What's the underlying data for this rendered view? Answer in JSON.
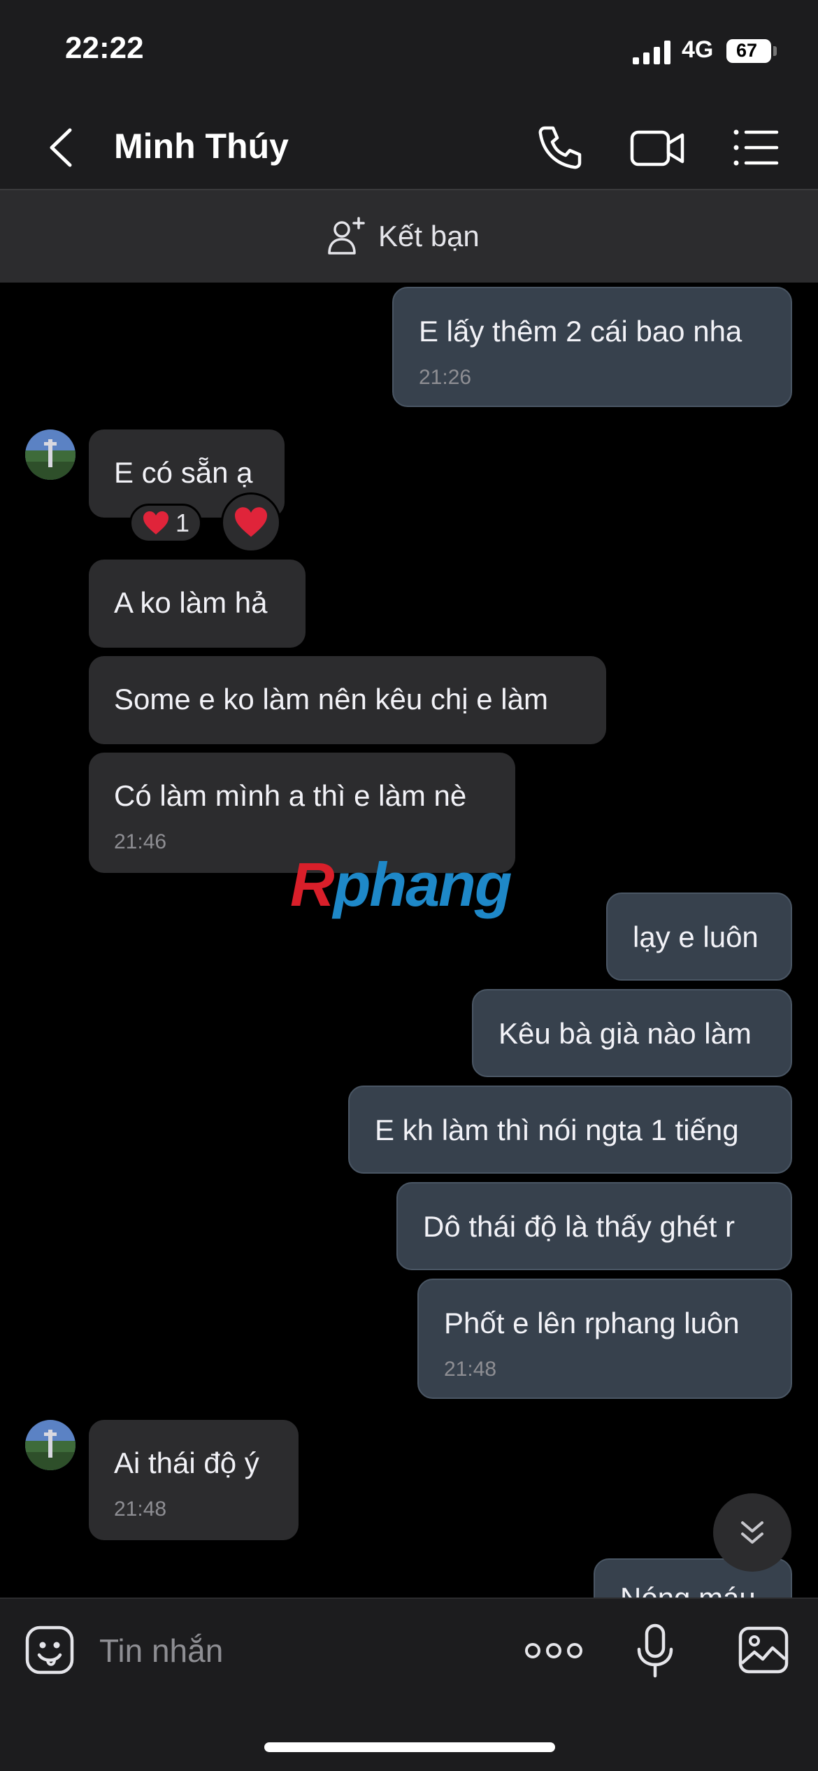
{
  "status_bar": {
    "time": "22:22",
    "network": "4G",
    "battery": "67"
  },
  "header": {
    "contact_name": "Minh Thúy",
    "icons": [
      "back-icon",
      "phone-icon",
      "video-icon",
      "menu-icon"
    ]
  },
  "friend_bar": {
    "label": "Kết bạn",
    "icon": "add-friend-icon"
  },
  "messages": [
    {
      "direction": "out",
      "text": "E lấy thêm 2 cái bao nha",
      "time": "21:26"
    },
    {
      "direction": "in",
      "text": "E có sẵn ạ",
      "reaction": "heart",
      "reaction_count": "1"
    },
    {
      "direction": "in",
      "text": "A ko làm hả"
    },
    {
      "direction": "in",
      "text": "Some e ko làm nên kêu chị e làm"
    },
    {
      "direction": "in",
      "text": "Có làm mình a thì e làm nè",
      "time": "21:46"
    },
    {
      "direction": "out",
      "text": "lạy e luôn"
    },
    {
      "direction": "out",
      "text": "Kêu bà già nào làm"
    },
    {
      "direction": "out",
      "text": "E kh làm thì nói ngta 1 tiếng"
    },
    {
      "direction": "out",
      "text": "Dô thái độ là thấy ghét r"
    },
    {
      "direction": "out",
      "text": "Phốt e lên rphang luôn",
      "time": "21:48"
    },
    {
      "direction": "in",
      "text": "Ai thái độ ý",
      "time": "21:48"
    },
    {
      "direction": "out",
      "text": "Nóng máu"
    }
  ],
  "watermark": {
    "first": "R",
    "rest": "phang"
  },
  "composer": {
    "placeholder": "Tin nhắn",
    "icons": [
      "sticker-icon",
      "more-icon",
      "mic-icon",
      "image-icon"
    ]
  },
  "colors": {
    "background": "#000000",
    "bar": "#1c1c1e",
    "incoming_bubble": "#2c2c2e",
    "outgoing_bubble": "#37414d",
    "timestamp": "#8e8e93",
    "heart": "#e0243a"
  }
}
